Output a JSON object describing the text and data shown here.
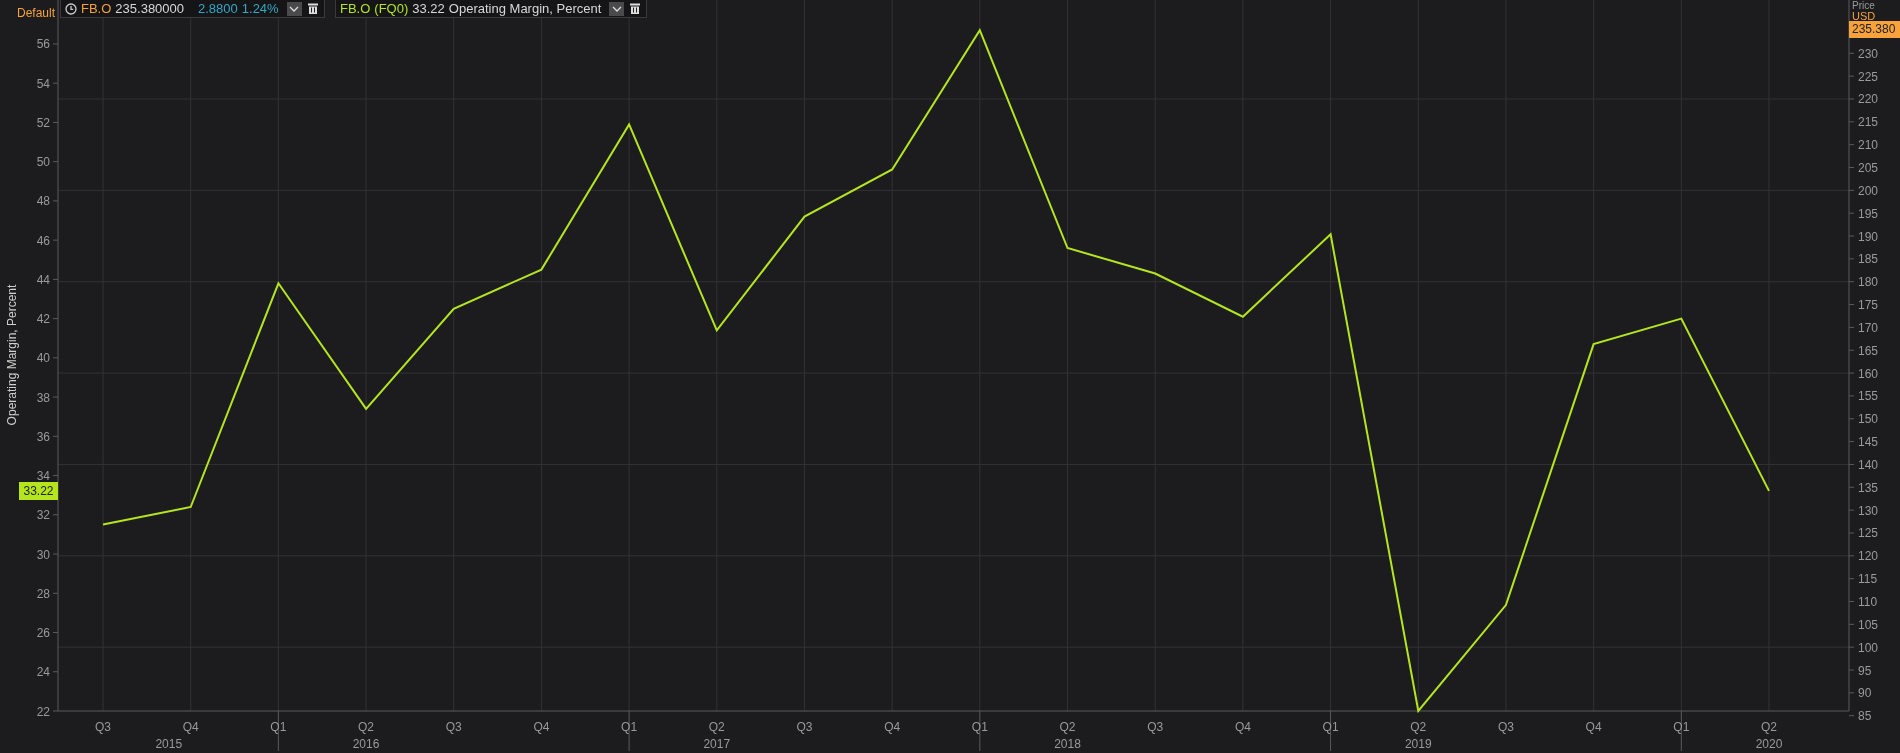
{
  "layout_label": "Default",
  "price_legend": {
    "symbol": "FB.O",
    "price": "235.380000",
    "change": "2.8800",
    "change_pct": "1.24%"
  },
  "series_legend": {
    "symbol": "FB.O",
    "period": "(FQ0)",
    "value": "33.22"
  },
  "chart_data": {
    "type": "line",
    "ylabel": "Operating Margin, Percent",
    "categories": [
      "Q3",
      "Q4",
      "Q1",
      "Q2",
      "Q3",
      "Q4",
      "Q1",
      "Q2",
      "Q3",
      "Q4",
      "Q1",
      "Q2",
      "Q3",
      "Q4",
      "Q1",
      "Q2",
      "Q3",
      "Q4",
      "Q1",
      "Q2"
    ],
    "series": [
      {
        "name": "Operating Margin, Percent",
        "color": "#b5e61d",
        "values": [
          31.5,
          32.4,
          43.8,
          37.4,
          42.5,
          44.5,
          51.9,
          41.4,
          47.2,
          49.6,
          56.7,
          45.6,
          44.3,
          42.1,
          46.3,
          22.0,
          27.4,
          40.7,
          42.0,
          33.22
        ]
      }
    ],
    "grid": true,
    "ylim": [
      22,
      58.24
    ],
    "yticks": [
      22,
      24,
      26,
      28,
      30,
      32,
      34,
      36,
      38,
      40,
      42,
      44,
      46,
      48,
      50,
      52,
      54,
      56
    ]
  },
  "current_value_label": "33.22",
  "year_labels": [
    "2015",
    "2016",
    "2017",
    "2018",
    "2019",
    "2020"
  ],
  "price_axis": {
    "title": "Price",
    "unit": "USD",
    "current_price": "235.380",
    "ticks": [
      "230",
      "225",
      "220",
      "215",
      "210",
      "205",
      "200",
      "195",
      "190",
      "185",
      "180",
      "175",
      "170",
      "165",
      "160",
      "155",
      "150",
      "145",
      "140",
      "135",
      "130",
      "125",
      "120",
      "115",
      "110",
      "105",
      "100",
      "95",
      "90",
      "85"
    ]
  }
}
